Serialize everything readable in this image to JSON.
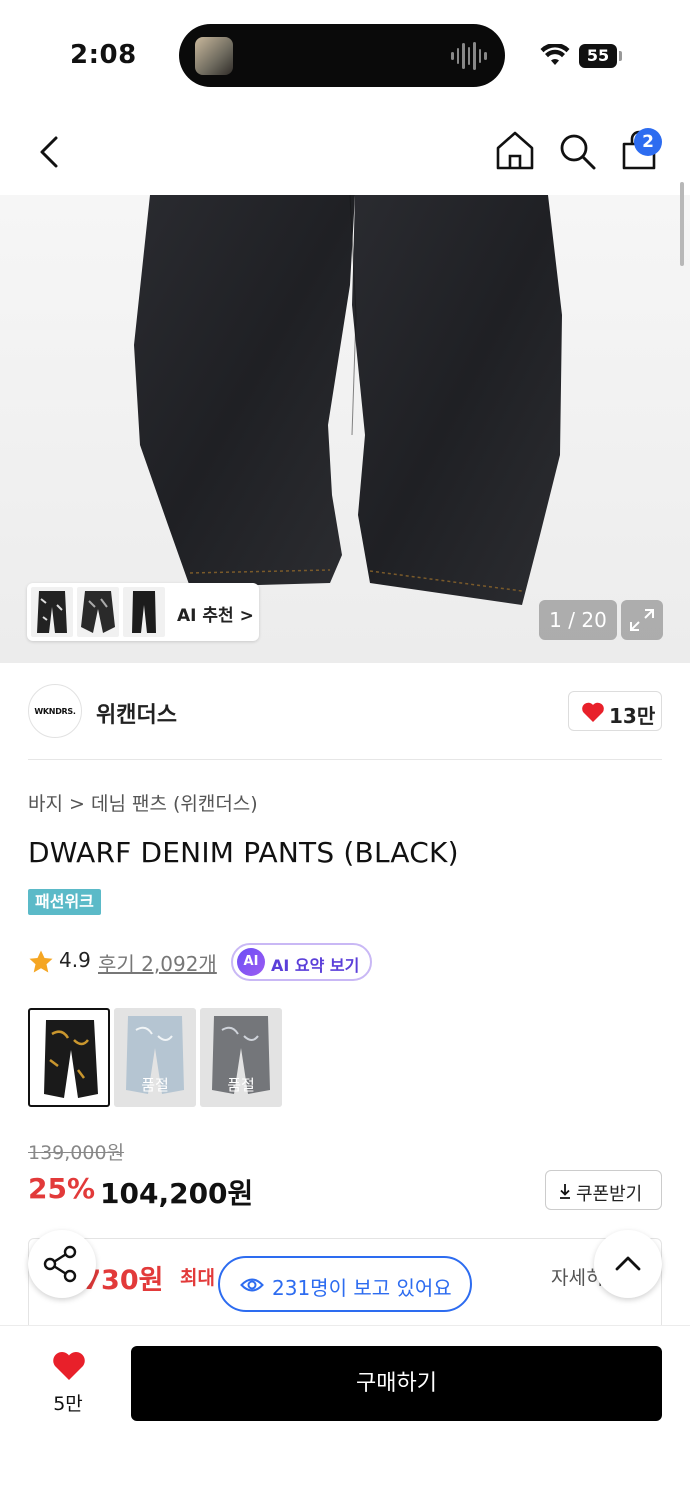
{
  "status_bar": {
    "time": "2:08",
    "battery": "55"
  },
  "nav": {
    "cart_count": "2"
  },
  "gallery": {
    "ai_recommend_label": "AI 추천 >",
    "counter": "1 / 20"
  },
  "brand": {
    "logo_text": "WKNDRS.",
    "name": "위캔더스",
    "like_count": "13만"
  },
  "product": {
    "breadcrumb": "바지 > 데님 팬츠 (위캔더스)",
    "title": "DWARF DENIM PANTS (BLACK)",
    "tag": "패션위크",
    "rating": "4.9",
    "reviews": "후기 2,092개",
    "ai_summary_badge": "AI",
    "ai_summary_label": "AI 요약 보기",
    "swatches": [
      {
        "status": ""
      },
      {
        "status": "품절"
      },
      {
        "status": "품절"
      }
    ],
    "original_price": "139,000원",
    "discount": "25%",
    "price": "104,200원",
    "coupon_label": "쿠폰받기"
  },
  "benefit": {
    "price": ",730원",
    "max_label": "최대",
    "detail_label": "자세히"
  },
  "viewers": {
    "text": "231명이 보고 있어요"
  },
  "bottom": {
    "wish_count": "5만",
    "buy_label": "구매하기"
  },
  "colors": {
    "accent_blue": "#2d6cf0",
    "sale_red": "#e23a3a",
    "tag_teal": "#5bbac8"
  }
}
